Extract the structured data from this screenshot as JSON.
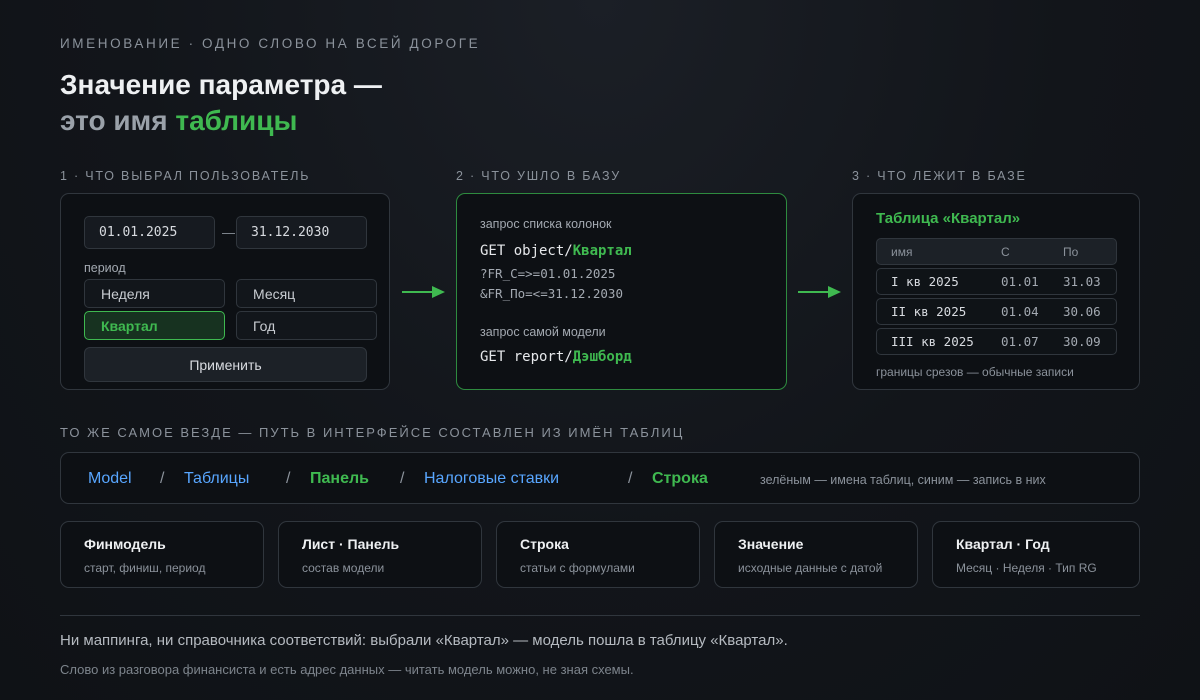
{
  "eyebrow": "ИМЕНОВАНИЕ · ОДНО СЛОВО НА ВСЕЙ ДОРОГЕ",
  "title": {
    "line1": "Значение параметра —",
    "line2_prefix": "это имя",
    "line2_accent": "таблицы"
  },
  "steps": [
    {
      "label": "1 · ЧТО ВЫБРАЛ ПОЛЬЗОВАТЕЛЬ"
    },
    {
      "label": "2 · ЧТО УШЛО В БАЗУ"
    },
    {
      "label": "3 · ЧТО ЛЕЖИТ В БАЗЕ"
    }
  ],
  "user_panel": {
    "date_from": "01.01.2025",
    "dash": "—",
    "date_to": "31.12.2030",
    "period_label": "период",
    "options": [
      {
        "label": "Неделя",
        "active": false
      },
      {
        "label": "Месяц",
        "active": false
      },
      {
        "label": "Квартал",
        "active": true
      },
      {
        "label": "Год",
        "active": false
      }
    ],
    "apply_label": "Применить"
  },
  "query_panel": {
    "columns_caption": "запрос списка колонок",
    "columns_method_path": "GET object/",
    "columns_table": "Квартал",
    "param1": "?FR_С=>=01.01.2025",
    "param2": "&FR_По=<=31.12.2030",
    "model_caption": "запрос самой модели",
    "model_method_path": "GET report/",
    "model_name": "Дэшборд"
  },
  "db_panel": {
    "title": "Таблица «Квартал»",
    "headers": [
      "имя",
      "С",
      "По"
    ],
    "rows": [
      [
        "I кв 2025",
        "01.01",
        "31.03"
      ],
      [
        "II кв 2025",
        "01.04",
        "30.06"
      ],
      [
        "III кв 2025",
        "01.07",
        "30.09"
      ]
    ],
    "note": "границы срезов — обычные записи"
  },
  "path_section": {
    "label": "ТО ЖЕ САМОЕ ВЕЗДЕ — ПУТЬ В ИНТЕРФЕЙСЕ СОСТАВЛЕН ИЗ ИМЁН ТАБЛИЦ",
    "separator": "/",
    "items": [
      {
        "text": "Model",
        "kind": "record"
      },
      {
        "text": "Таблицы",
        "kind": "record"
      },
      {
        "text": "Панель",
        "kind": "table"
      },
      {
        "text": "Налоговые ставки",
        "kind": "record"
      },
      {
        "text": "Строка",
        "kind": "table"
      }
    ],
    "legend": "зелёным — имена таблиц, синим — запись в них",
    "colors": {
      "table": "#3fb950",
      "record": "#58a6ff"
    }
  },
  "cards": [
    {
      "title": "Финмодель",
      "subtitle": "старт, финиш, период"
    },
    {
      "title": "Лист · Панель",
      "subtitle": "состав модели"
    },
    {
      "title": "Строка",
      "subtitle": "статьи с формулами"
    },
    {
      "title": "Значение",
      "subtitle": "исходные данные с датой"
    },
    {
      "title": "Квартал · Год",
      "subtitle": "Месяц · Неделя · Тип RG"
    }
  ],
  "footer": {
    "line1": "Ни маппинга, ни справочника соответствий: выбрали «Квартал» — модель пошла в таблицу «Квартал».",
    "line2": "Слово из разговора финансиста и есть адрес данных — читать модель можно, не зная схемы."
  },
  "accent_color": "#3fb950"
}
